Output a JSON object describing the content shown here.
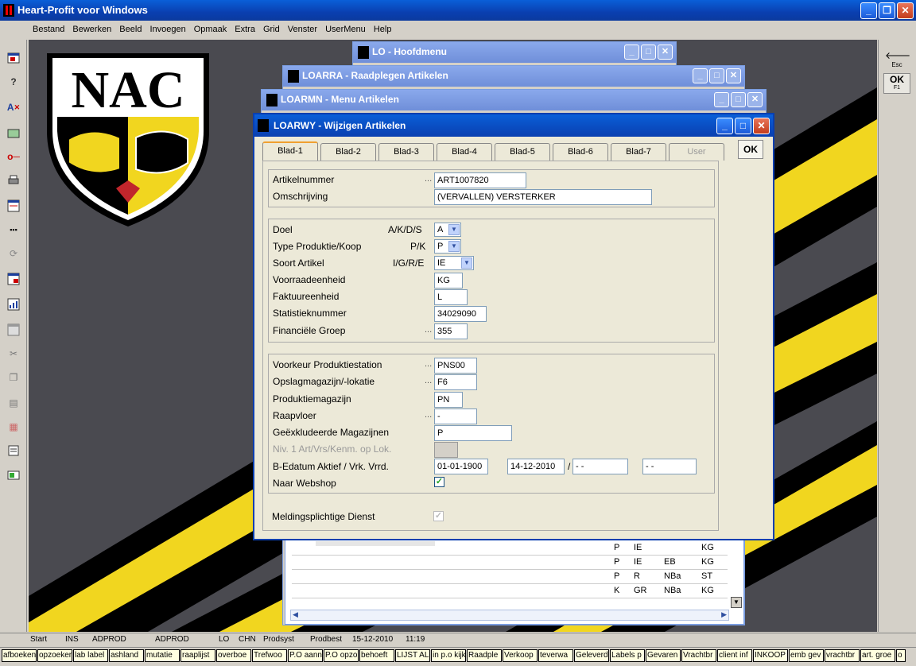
{
  "app": {
    "title": "Heart-Profit voor Windows"
  },
  "menu": [
    "Bestand",
    "Bewerken",
    "Beeld",
    "Invoegen",
    "Opmaak",
    "Extra",
    "Grid",
    "Venster",
    "UserMenu",
    "Help"
  ],
  "logo": {
    "text": "NAC"
  },
  "right_toolbar": {
    "esc_label": "Esc",
    "ok_label": "OK",
    "ok_sub": "F1"
  },
  "windows": {
    "main_menu": "LO - Hoofdmenu",
    "raadplegen": "LOARRA - Raadplegen Artikelen",
    "menu_artikelen": "LOARMN - Menu Artikelen"
  },
  "dialog": {
    "title": "LOARWY - Wijzigen Artikelen",
    "ok_label": "OK",
    "tabs": [
      "Blad-1",
      "Blad-2",
      "Blad-3",
      "Blad-4",
      "Blad-5",
      "Blad-6",
      "Blad-7",
      "User"
    ],
    "group1": {
      "artikelnummer_label": "Artikelnummer",
      "artikelnummer_value": "ART1007820",
      "omschrijving_label": "Omschrijving",
      "omschrijving_value": "(VERVALLEN) VERSTERKER"
    },
    "group2": {
      "doel_label": "Doel",
      "doel_code": "A/K/D/S",
      "doel_value": "A",
      "type_label": "Type Produktie/Koop",
      "type_code": "P/K",
      "type_value": "P",
      "soort_label": "Soort Artikel",
      "soort_code": "I/G/R/E",
      "soort_value": "IE",
      "voorraad_label": "Voorraadeenheid",
      "voorraad_value": "KG",
      "faktuur_label": "Faktuureenheid",
      "faktuur_value": "L",
      "statistiek_label": "Statistieknummer",
      "statistiek_value": "34029090",
      "financieel_label": "Financiële Groep",
      "financieel_value": "355"
    },
    "group3": {
      "voorkeur_label": "Voorkeur Produktiestation",
      "voorkeur_value": "PNS00",
      "opslag_label": "Opslagmagazijn/-lokatie",
      "opslag_value": "F6",
      "produktiemag_label": "Produktiemagazijn",
      "produktiemag_value": "PN",
      "raapvloer_label": "Raapvloer",
      "raapvloer_value": "-",
      "geexcl_label": "Geëxkludeerde Magazijnen",
      "geexcl_value": "P",
      "niv1_label": "Niv. 1 Art/Vrs/Kenm. op Lok.",
      "bedatum_label": "B-Edatum Aktief / Vrk. Vrrd.",
      "bedatum_values": [
        "01-01-1900",
        "14-12-2010",
        "- -",
        "- -"
      ],
      "bedatum_sep": "/",
      "webshop_label": "Naar Webshop"
    },
    "meldings_label": "Meldingsplichtige Dienst"
  },
  "table_rows": [
    [
      "P",
      "IE",
      "",
      "KG"
    ],
    [
      "P",
      "IE",
      "EB",
      "KG"
    ],
    [
      "P",
      "R",
      "NBa",
      "ST"
    ],
    [
      "K",
      "GR",
      "NBa",
      "KG"
    ]
  ],
  "status": [
    "Start",
    "INS",
    "ADPROD",
    "ADPROD",
    "LO",
    "CHN",
    "Prodsyst",
    "Prodbest",
    "15-12-2010",
    "11:19"
  ],
  "tasks": [
    "afboeken",
    "opzoeken",
    "lab label",
    "ashland",
    "mutatie",
    "raaplijst",
    "overboe",
    "Trefwoo",
    "P.O aann",
    "P.O opzo",
    "behoeft",
    "LIJST AL",
    "in p.o kijk",
    "Raadple",
    "Verkoop",
    "teverwa",
    "Geleverd",
    "Labels p",
    "Gevaren",
    "Vrachtbr",
    "client inf",
    "INKOOP",
    "emb gev",
    "vrachtbr",
    "art. groe",
    "o"
  ]
}
